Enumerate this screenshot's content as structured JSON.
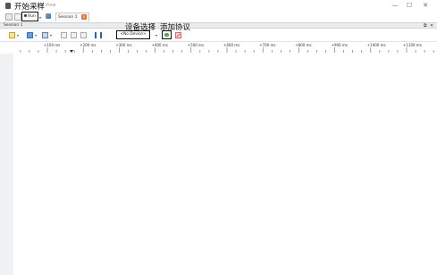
{
  "window": {
    "title": "Pulse View",
    "controls": {
      "minimize": "—",
      "maximize": "☐",
      "close": "✕"
    }
  },
  "annotations": {
    "start_sampling": "开始采样",
    "device_select": "设备选择",
    "add_protocol": "添加协议"
  },
  "topbar": {
    "run_label": "Run",
    "session_tab_label": "Session 1"
  },
  "session_strip": {
    "label": "Session 1",
    "pin": "⧉",
    "close": "✕"
  },
  "toolbar": {
    "device_label": "<No Device>",
    "device_caret": "▾"
  },
  "ruler": {
    "ticks": [
      "+100 ms",
      "+200 ms",
      "+300 ms",
      "+400 ms",
      "+500 ms",
      "+600 ms",
      "+700 ms",
      "+800 ms",
      "+900 ms",
      "+1000 ms",
      "+1100 ms"
    ]
  },
  "colors": {
    "accent_green": "#4caf3d",
    "tab_close_orange": "#e8743b",
    "strip_bg": "#e9ebee"
  }
}
